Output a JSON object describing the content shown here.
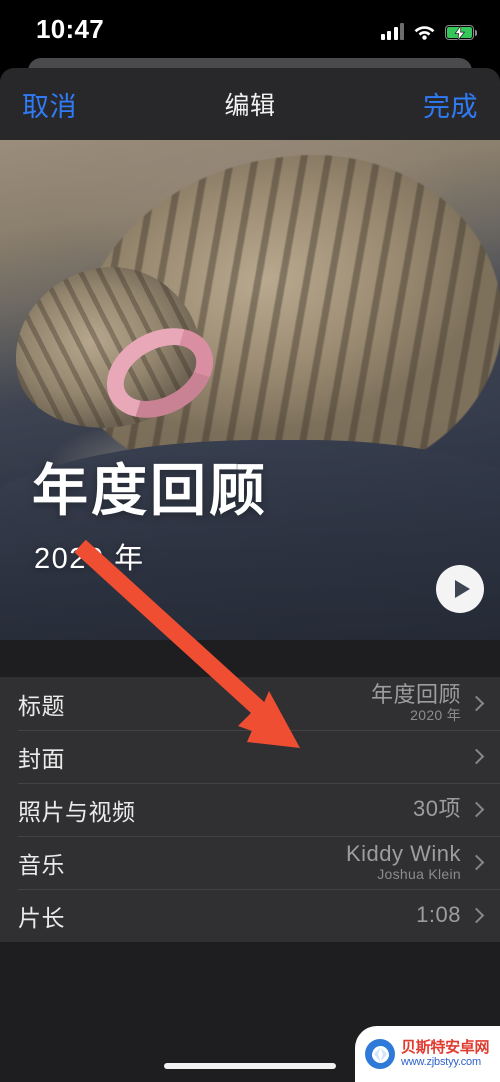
{
  "status_bar": {
    "time": "10:47",
    "cellular_icon": "cellular-bars-icon",
    "wifi_icon": "wifi-icon",
    "battery_icon": "battery-charging-icon",
    "battery_color": "#35c759"
  },
  "nav": {
    "cancel_label": "取消",
    "title": "编辑",
    "done_label": "完成",
    "accent_color": "#2f7bf6"
  },
  "hero": {
    "title": "年度回顾",
    "subtitle": "2020 年",
    "play_button_label": "play-button"
  },
  "list": {
    "rows": [
      {
        "label": "标题",
        "value": "年度回顾",
        "sub": "2020 年",
        "chevron": "chevron-right-icon"
      },
      {
        "label": "封面",
        "value": "",
        "sub": "",
        "chevron": "chevron-right-icon"
      },
      {
        "label": "照片与视频",
        "value": "30项",
        "sub": "",
        "chevron": "chevron-right-icon"
      },
      {
        "label": "音乐",
        "value": "Kiddy Wink",
        "sub": "Joshua Klein",
        "chevron": "chevron-right-icon"
      },
      {
        "label": "片长",
        "value": "1:08",
        "sub": "",
        "chevron": "chevron-right-icon"
      }
    ]
  },
  "annotations": {
    "arrow_color": "#f04e32",
    "highlight_color": "#f04e32",
    "highlight_target_row": "照片与视频"
  },
  "watermark": {
    "site_name": "贝斯特安卓网",
    "site_url": "www.zjbstyy.com",
    "logo_icon": "shell-logo-icon",
    "name_color": "#e03b2f",
    "url_color": "#2f62c8"
  }
}
